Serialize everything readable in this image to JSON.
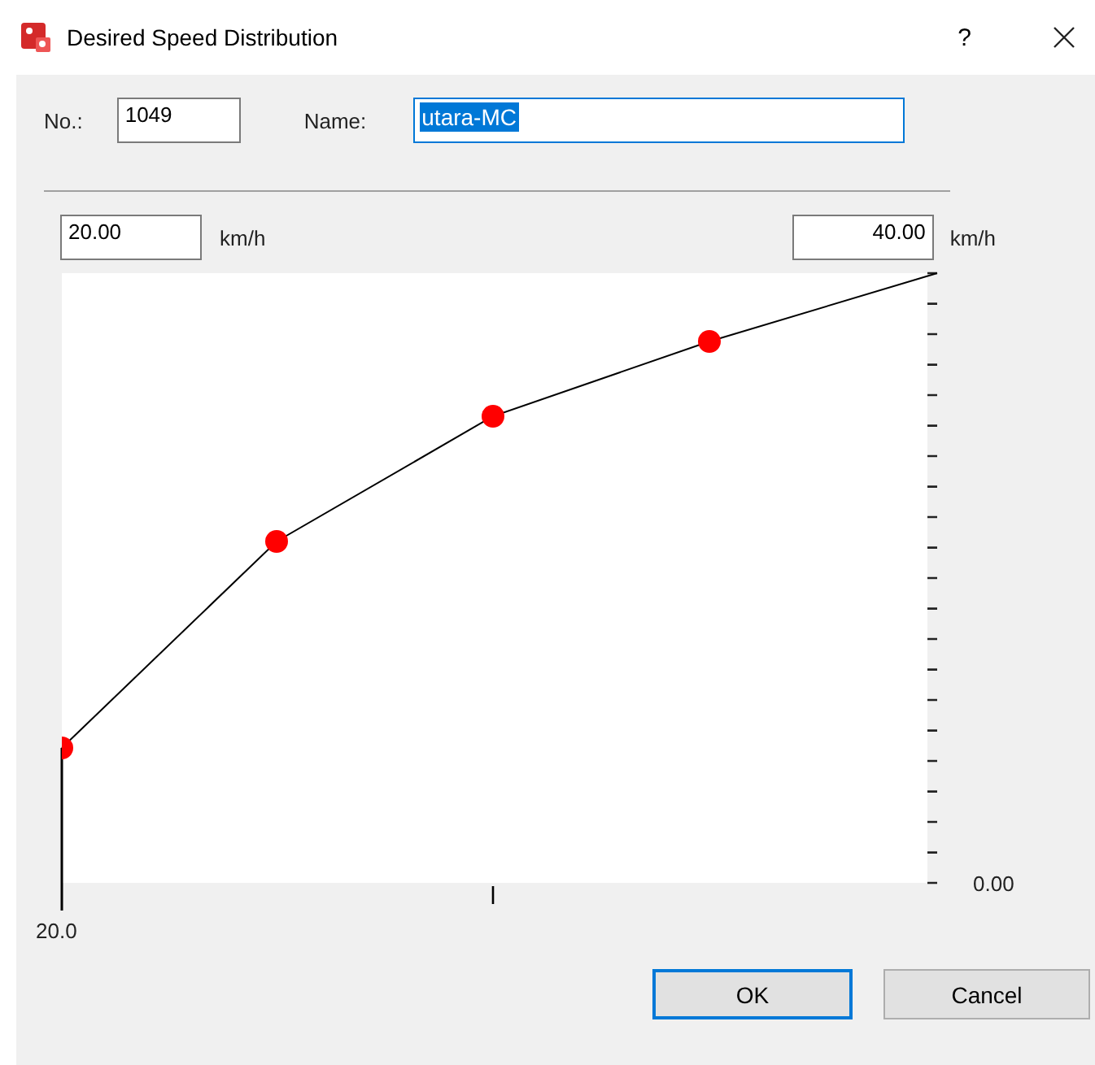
{
  "window": {
    "title": "Desired Speed Distribution",
    "help": "?"
  },
  "number": {
    "label": "No.:",
    "value": "1049"
  },
  "name": {
    "label": "Name:",
    "value": "utara-MC",
    "selected": true
  },
  "range": [
    {
      "kind": "min",
      "value": "20.00",
      "unit": "km/h"
    },
    {
      "kind": "max",
      "value": "40.00",
      "unit": "km/h"
    }
  ],
  "plot": {
    "x_start": "20.0",
    "y_start": "0.00"
  },
  "buttons": [
    {
      "label": "OK",
      "default": true
    },
    {
      "label": "Cancel",
      "default": false
    }
  ]
}
